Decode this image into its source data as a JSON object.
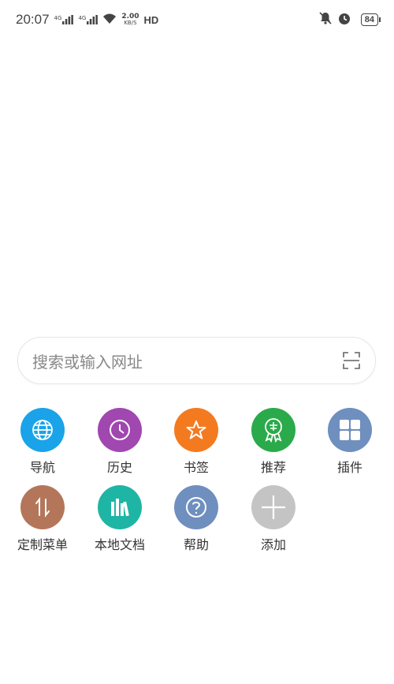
{
  "status_bar": {
    "time": "20:07",
    "signal1": "4G",
    "signal2": "4G",
    "speed_value": "2.00",
    "speed_unit": "KB/S",
    "hd": "HD",
    "battery": "84"
  },
  "search": {
    "placeholder": "搜索或输入网址"
  },
  "shortcuts": [
    {
      "label": "导航",
      "icon": "globe-icon",
      "color": "#1aa3e8"
    },
    {
      "label": "历史",
      "icon": "clock-icon",
      "color": "#a047b0"
    },
    {
      "label": "书签",
      "icon": "star-icon",
      "color": "#f47a20"
    },
    {
      "label": "推荐",
      "icon": "recommend-badge-icon",
      "color": "#2aaa4a"
    },
    {
      "label": "插件",
      "icon": "grid-icon",
      "color": "#6f8fbf"
    },
    {
      "label": "定制菜单",
      "icon": "sort-arrows-icon",
      "color": "#b4765a"
    },
    {
      "label": "本地文档",
      "icon": "books-icon",
      "color": "#1fb5a5"
    },
    {
      "label": "帮助",
      "icon": "question-icon",
      "color": "#6f8fbf"
    },
    {
      "label": "添加",
      "icon": "plus-icon",
      "color": "#c4c4c4"
    }
  ]
}
